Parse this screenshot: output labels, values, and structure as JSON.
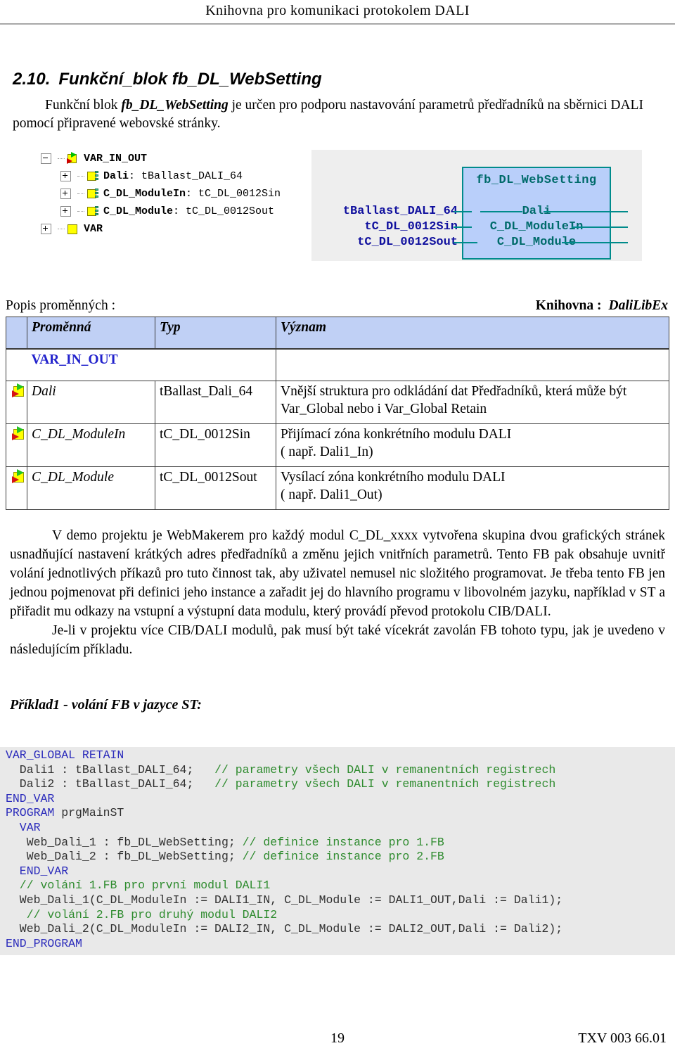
{
  "header": {
    "running_title": "Knihovna  pro komunikaci protokolem DALI"
  },
  "section": {
    "number": "2.10.",
    "title": "Funkční_blok fb_DL_WebSetting",
    "intro_part1": "Funkční blok ",
    "intro_emph": "fb_DL_WebSetting",
    "intro_part2": " je určen pro podporu nastavování parametrů předřadníků na sběrnici DALI pomocí připravené webovské stránky."
  },
  "diagram": {
    "tree": [
      {
        "expander": "minus",
        "icon": "var-in-out-icon",
        "name": "VAR_IN_OUT",
        "type": "",
        "indent": false
      },
      {
        "expander": "plus",
        "icon": "struct-variable-icon",
        "name": "Dali",
        "type": " : tBallast_DALI_64",
        "indent": true
      },
      {
        "expander": "plus",
        "icon": "struct-variable-icon",
        "name": "C_DL_ModuleIn",
        "type": " : tC_DL_0012Sin",
        "indent": true
      },
      {
        "expander": "plus",
        "icon": "struct-variable-icon",
        "name": "C_DL_Module",
        "type": " : tC_DL_0012Sout",
        "indent": true
      },
      {
        "expander": "plus",
        "icon": "variable-icon",
        "name": "VAR",
        "type": "",
        "indent": false
      }
    ],
    "fb": {
      "title": "fb_DL_WebSetting",
      "ports": [
        {
          "left_type": "tBallast_DALI_64",
          "name": "Dali"
        },
        {
          "left_type": "tC_DL_0012Sin",
          "name": "C_DL_ModuleIn"
        },
        {
          "left_type": "tC_DL_0012Sout",
          "name": "C_DL_Module"
        }
      ],
      "box_fill": "#b9cffa",
      "box_border": "#008b8b",
      "label_color": "#006b6b",
      "type_color": "#10109e",
      "panel_bg": "#eeeeee"
    }
  },
  "table_caption": {
    "left": "Popis proměnných :",
    "right_label": "Knihovna :",
    "right_value": "DaliLibEx"
  },
  "var_table": {
    "header_fill": "#c0d0f5",
    "columns": [
      "",
      "Proměnná",
      "Typ",
      "Význam"
    ],
    "group_label": "VAR_IN_OUT",
    "group_color": "#2222cc",
    "rows": [
      {
        "icon": "var-in-out-icon",
        "name": "Dali",
        "type": "tBallast_Dali_64",
        "meaning": "Vnější struktura pro odkládání dat Předřadníků, která může být Var_Global nebo i  Var_Global Retain"
      },
      {
        "icon": "var-in-out-icon",
        "name": "C_DL_ModuleIn",
        "type": "tC_DL_0012Sin",
        "meaning": "Přijímací zóna konkrétního modulu DALI\n ( např. Dali1_In)"
      },
      {
        "icon": "var-in-out-icon",
        "name": "C_DL_Module",
        "type": "tC_DL_0012Sout",
        "meaning": "Vysílací zóna konkrétního modulu DALI\n( např. Dali1_Out)"
      }
    ]
  },
  "body": {
    "para1": "V demo projektu je WebMakerem pro každý modul C_DL_xxxx vytvořena skupina dvou grafických stránek usnadňující nastavení krátkých adres předřadníků a změnu jejich vnitřních parametrů. Tento FB pak obsahuje uvnitř volání jednotlivých příkazů pro tuto činnost tak, aby uživatel nemusel nic složitého programovat. Je třeba tento FB jen jednou pojmenovat při definici jeho instance a zařadit jej do hlavního programu v libovolném jazyku, například v ST a přiřadit mu odkazy na vstupní a výstupní data modulu, který provádí převod protokolu CIB/DALI.",
    "para2": "Je-li v projektu více CIB/DALI modulů, pak musí být také vícekrát zavolán FB tohoto typu, jak je uvedeno v následujícím příkladu.",
    "example_title": "Příklad1 -  volání FB v jazyce ST:"
  },
  "code": {
    "keyword_color": "#2b2bbb",
    "comment_color": "#2e8b2e",
    "text_color": "#303030",
    "background": "#e9e9e9",
    "lines": [
      [
        {
          "t": "kw",
          "s": "VAR_GLOBAL RETAIN"
        }
      ],
      [
        {
          "t": "tx",
          "s": "  Dali1 : tBallast_DALI_64;   "
        },
        {
          "t": "cm",
          "s": "// parametry všech DALI v remanentních registrech"
        }
      ],
      [
        {
          "t": "tx",
          "s": "  Dali2 : tBallast_DALI_64;   "
        },
        {
          "t": "cm",
          "s": "// parametry všech DALI v remanentních registrech"
        }
      ],
      [
        {
          "t": "kw",
          "s": "END_VAR"
        }
      ],
      [
        {
          "t": "kw",
          "s": "PROGRAM"
        },
        {
          "t": "tx",
          "s": " prgMainST"
        }
      ],
      [
        {
          "t": "kw",
          "s": "  VAR"
        }
      ],
      [
        {
          "t": "tx",
          "s": "   Web_Dali_1 : fb_DL_WebSetting; "
        },
        {
          "t": "cm",
          "s": "// definice instance pro 1.FB"
        }
      ],
      [
        {
          "t": "tx",
          "s": "   Web_Dali_2 : fb_DL_WebSetting; "
        },
        {
          "t": "cm",
          "s": "// definice instance pro 2.FB"
        }
      ],
      [
        {
          "t": "kw",
          "s": "  END_VAR"
        }
      ],
      [
        {
          "t": "cm",
          "s": "  // volání 1.FB pro první modul DALI1"
        }
      ],
      [
        {
          "t": "tx",
          "s": "  Web_Dali_1(C_DL_ModuleIn := DALI1_IN, C_DL_Module := DALI1_OUT,Dali := Dali1);"
        }
      ],
      [
        {
          "t": "cm",
          "s": "   // volání 2.FB pro druhý modul DALI2"
        }
      ],
      [
        {
          "t": "tx",
          "s": "  Web_Dali_2(C_DL_ModuleIn := DALI2_IN, C_DL_Module := DALI2_OUT,Dali := Dali2);"
        }
      ],
      [
        {
          "t": "kw",
          "s": "END_PROGRAM"
        }
      ]
    ]
  },
  "footer": {
    "page_number": "19",
    "doc_code": "TXV 003 66.01"
  }
}
